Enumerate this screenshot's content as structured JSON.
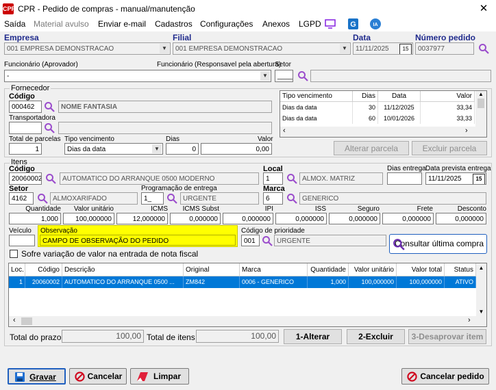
{
  "window": {
    "title": "CPR - Pedido de compras - manual/manutenção",
    "app_icon": "CPR"
  },
  "menu": [
    {
      "label": "Saída"
    },
    {
      "label": "Material avulso"
    },
    {
      "label": "Enviar e-mail"
    },
    {
      "label": "Cadastros"
    },
    {
      "label": "Configurações"
    },
    {
      "label": "Anexos"
    },
    {
      "label": "LGPD"
    }
  ],
  "header": {
    "empresa_label": "Empresa",
    "empresa_value": "001 EMPRESA DEMONSTRACAO",
    "filial_label": "Filial",
    "filial_value": "001 EMPRESA DEMONSTRACAO",
    "data_label": "Data",
    "data_value": "11/11/2025",
    "numero_label": "Número pedido",
    "numero_value": "0037977",
    "funcionario_label": "Funcionário (Aprovador)",
    "funcionario_value": "-",
    "func_resp_label": "Funcionário (Responsavel pela abertura)",
    "setor_label": "Setor",
    "setor_value": "____",
    "cal_icon": "15"
  },
  "fornecedor": {
    "group_label": "Fornecedor",
    "codigo_label": "Código",
    "codigo_value": "000462",
    "nome_value": "NOME FANTASIA",
    "transportadora_label": "Transportadora",
    "total_parcelas_label": "Total de parcelas",
    "total_parcelas_value": "1",
    "tipo_venc_label": "Tipo vencimento",
    "tipo_venc_value": "Dias da data",
    "dias_label": "Dias",
    "dias_value": "0",
    "valor_label": "Valor",
    "valor_value": "0,00",
    "table_headers": [
      "Tipo vencimento",
      "Dias",
      "Data",
      "Valor"
    ],
    "table_rows": [
      [
        "Dias da data",
        "30",
        "11/12/2025",
        "33,34"
      ],
      [
        "Dias da data",
        "60",
        "10/01/2026",
        "33,33"
      ]
    ],
    "alterar_parcela": "Alterar parcela",
    "excluir_parcela": "Excluir parcela"
  },
  "itens": {
    "group_label": "Itens",
    "codigo_label": "Código",
    "codigo_value": "20060002",
    "descricao_value": "AUTOMATICO DO ARRANQUE 0500 MODERNO",
    "local_label": "Local",
    "local_code": "1",
    "local_value": "ALMOX. MATRIZ",
    "dias_entrega_label": "Dias entrega",
    "data_prevista_label": "Data prevista entrega",
    "data_prevista_value": "11/11/2025",
    "setor_label": "Setor",
    "setor_code": "4162",
    "setor_value": "ALMOXARIFADO",
    "prog_label": "Programação de entrega",
    "prog_code": "1_",
    "prog_value": "URGENTE",
    "marca_label": "Marca",
    "marca_code": "6",
    "marca_value": "GENERICO",
    "num_labels": [
      "Quantidade",
      "Valor unitário",
      "ICMS",
      "ICMS Subst",
      "IPI",
      "ISS",
      "Seguro",
      "Frete",
      "Desconto"
    ],
    "num_values": [
      "1,000",
      "100,000000",
      "12,000000",
      "0,000000",
      "0,000000",
      "0,000000",
      "0,000000",
      "0,000000",
      "0,000000"
    ],
    "veiculo_label": "Veículo",
    "observacao_label": "Observação",
    "observacao_value": "CAMPO DE OBSERVAÇÃO DO PEDIDO",
    "prioridade_label": "Código de prioridade",
    "prioridade_code": "001",
    "prioridade_value": "URGENTE",
    "consultar_label": "Consultar última compra",
    "checkbox_label": "Sofre variação de valor na entrada de nota fiscal",
    "grid_headers": [
      "Loc.",
      "Código",
      "Descrição",
      "Original",
      "Marca",
      "Quantidade",
      "Valor unitário",
      "Valor total",
      "Status"
    ],
    "grid_rows": [
      [
        "1",
        "20060002",
        "AUTOMATICO DO ARRANQUE 0500 ...",
        "ZM842",
        "0006 - GENERICO",
        "1,000",
        "100,000000",
        "100,000000",
        "ATIVO"
      ]
    ],
    "total_prazo_label": "Total do prazo",
    "total_prazo_value": "100,00",
    "total_itens_label": "Total de itens",
    "total_itens_value": "100,00",
    "btn_alterar": "1-Alterar",
    "btn_excluir": "2-Excluir",
    "btn_desaprovar": "3-Desaprovar item"
  },
  "footer": {
    "gravar": "Gravar",
    "cancelar": "Cancelar",
    "limpar": "Limpar",
    "cancelar_pedido": "Cancelar pedido"
  },
  "colors": {
    "accent_blue": "#1f2a8c",
    "selection": "#0078d7",
    "highlight": "#ffff00",
    "magnifier": "#9b4dcc"
  }
}
